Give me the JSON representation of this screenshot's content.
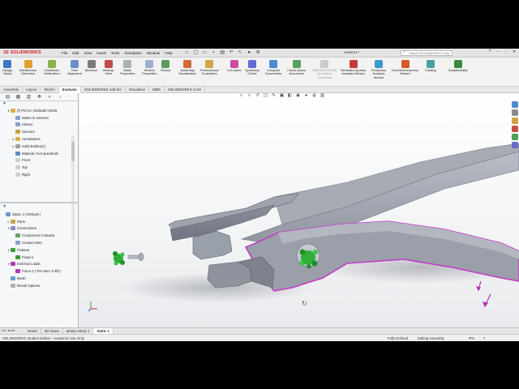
{
  "app": {
    "logo_text": "SOLIDWORKS",
    "doc_title": "Assem1 *"
  },
  "menu": [
    "File",
    "Edit",
    "View",
    "Insert",
    "Tools",
    "Simulation",
    "Window",
    "Help"
  ],
  "search": {
    "placeholder": "Search SOLIDWORKS Help"
  },
  "command_manager": [
    {
      "label": "Design\nStudy",
      "color": "#3a78c3"
    },
    {
      "label": "Interference\nDetection",
      "color": "#e0a030"
    },
    {
      "label": "Clearance\nVerification",
      "color": "#8db04a"
    },
    {
      "label": "Hole\nAlignment",
      "color": "#6a8fc4"
    },
    {
      "label": "Measure",
      "color": "#7a7a7a"
    },
    {
      "label": "Markup\nView",
      "color": "#c04a4a"
    },
    {
      "label": "Mass\nProperties",
      "color": "#b0b0b0"
    },
    {
      "label": "Section\nProperties",
      "color": "#9ab2d0"
    },
    {
      "label": "Sensor",
      "color": "#5a9a5a"
    },
    {
      "label": "Assembly\nVisualization",
      "color": "#d06a3a"
    },
    {
      "label": "Performance\nEvaluation",
      "color": "#d3a545"
    },
    {
      "label": "Curvature",
      "color": "#d04aa0"
    },
    {
      "label": "Symmetry\nCheck",
      "color": "#6a6ad0"
    },
    {
      "label": "Compare\nDocuments",
      "color": "#4a8ad0"
    },
    {
      "label": "Check Active\nDocument",
      "color": "#5aa05a"
    },
    {
      "label": "SIMPRESSIONS\nSimulation\nConnector",
      "color": "#999999",
      "disabled": true
    },
    {
      "label": "SimulationXpress\nAnalysis Wizard",
      "color": "#c43a3a"
    },
    {
      "label": "FloXpress\nAnalysis\nWizard",
      "color": "#3a9ad0"
    },
    {
      "label": "DriveWorksXpress\nWizard",
      "color": "#d05a2a"
    },
    {
      "label": "Costing",
      "color": "#4aa0a0"
    },
    {
      "label": "Sustainability",
      "color": "#3a8a3a"
    }
  ],
  "command_tabs": [
    {
      "label": "Assembly"
    },
    {
      "label": "Layout"
    },
    {
      "label": "Sketch"
    },
    {
      "label": "Evaluate",
      "active": true
    },
    {
      "label": "SOLIDWORKS Add-Ins"
    },
    {
      "label": "Simulation"
    },
    {
      "label": "MBD"
    },
    {
      "label": "SOLIDWORKS CAM"
    }
  ],
  "feature_tree": [
    {
      "label": "(f) Pin<1> (Default<<Defa",
      "indent": 1,
      "twisty": "▾",
      "color": "#d7b44a"
    },
    {
      "label": "Mates in Assem3",
      "indent": 2,
      "twisty": "",
      "color": "#8aa0c8"
    },
    {
      "label": "History",
      "indent": 2,
      "twisty": "",
      "color": "#8aa0c8"
    },
    {
      "label": "Sensors",
      "indent": 2,
      "twisty": "",
      "color": "#c7a040"
    },
    {
      "label": "Annotations",
      "indent": 2,
      "twisty": "▸",
      "color": "#d6b04a"
    },
    {
      "label": "Solid Bodies(1)",
      "indent": 2,
      "twisty": "▸",
      "color": "#a0a0a0"
    },
    {
      "label": "Material <not specified>",
      "indent": 2,
      "twisty": "",
      "color": "#5a8ac0"
    },
    {
      "label": "Front",
      "indent": 2,
      "twisty": "",
      "color": "#cfcfcf"
    },
    {
      "label": "Top",
      "indent": 2,
      "twisty": "",
      "color": "#cfcfcf"
    },
    {
      "label": "Right",
      "indent": 2,
      "twisty": "",
      "color": "#cfcfcf"
    }
  ],
  "sim_tree": [
    {
      "label": "Static 1 (-Default-)",
      "indent": 0,
      "twisty": "",
      "color": "#6a9ad0"
    },
    {
      "label": "Parts",
      "indent": 1,
      "twisty": "▸",
      "color": "#c9a24a"
    },
    {
      "label": "Connections",
      "indent": 1,
      "twisty": "▾",
      "color": "#8a8ac8"
    },
    {
      "label": "Component Contacts",
      "indent": 2,
      "twisty": "",
      "color": "#6aa06a"
    },
    {
      "label": "Contact Sets",
      "indent": 2,
      "twisty": "",
      "color": "#8aa0c8"
    },
    {
      "label": "Fixtures",
      "indent": 1,
      "twisty": "▾",
      "color": "#3aa03a"
    },
    {
      "label": "Fixed-1",
      "indent": 2,
      "twisty": "",
      "color": "#3aa03a"
    },
    {
      "label": "External Loads",
      "indent": 1,
      "twisty": "▾",
      "color": "#b03ab0"
    },
    {
      "label": "Force-1 (:Per item: 5 lbf:)",
      "indent": 2,
      "twisty": "",
      "color": "#b03ab0"
    },
    {
      "label": "Mesh",
      "indent": 1,
      "twisty": "",
      "color": "#6a9ad0"
    },
    {
      "label": "Result Options",
      "indent": 1,
      "twisty": "",
      "color": "#b0b0b0"
    }
  ],
  "model_tabs": [
    {
      "label": "Model"
    },
    {
      "label": "3D Views"
    },
    {
      "label": "Motion Study 1"
    },
    {
      "label": "Static 1",
      "active": true
    }
  ],
  "status": {
    "edition": "SOLIDWORKS Student Edition - Academic Use Only",
    "definition": "Fully Defined",
    "mode": "Editing Assembly",
    "units": "IPS"
  }
}
